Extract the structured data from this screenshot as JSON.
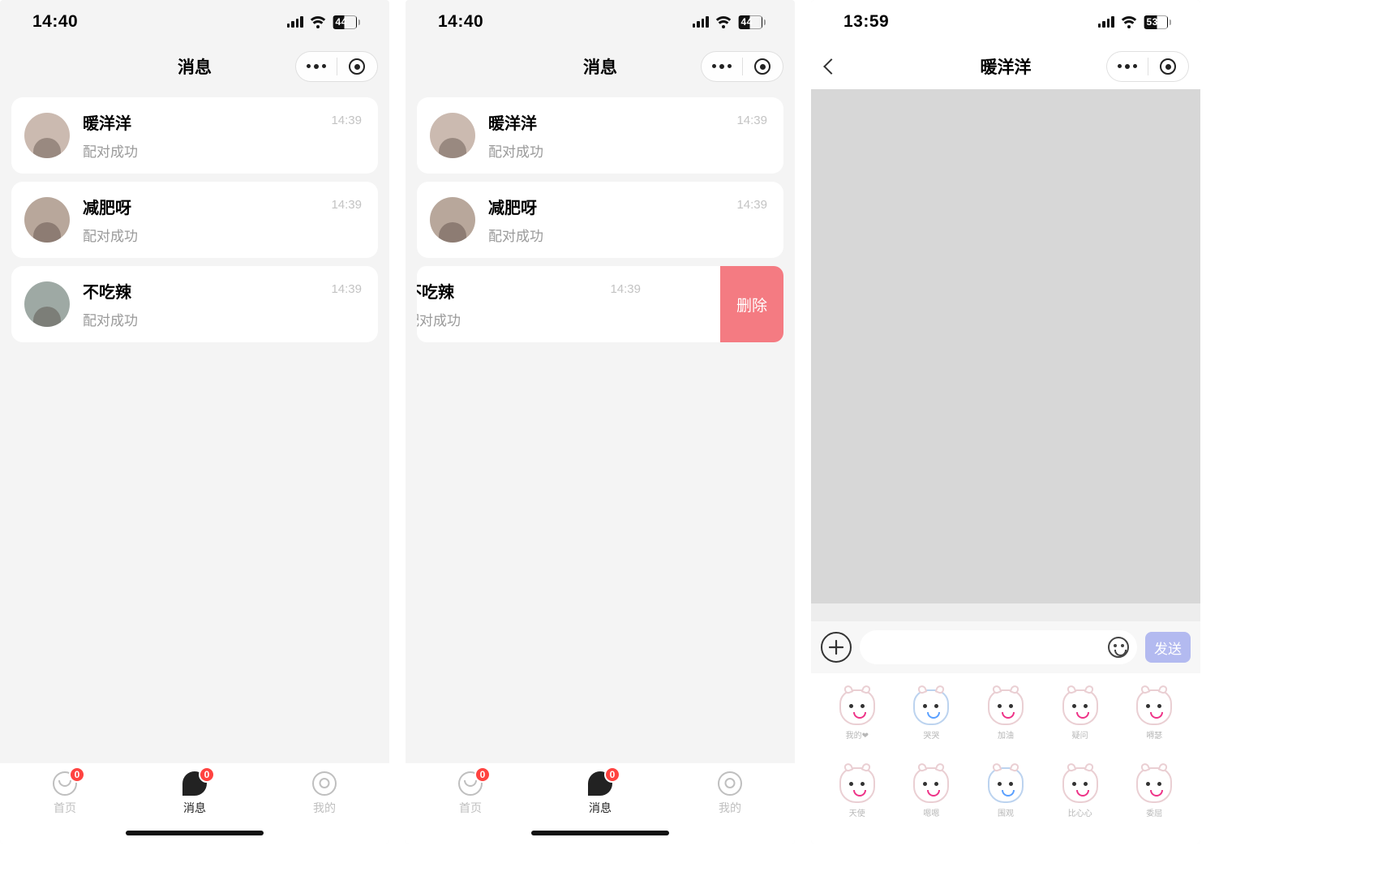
{
  "screens": {
    "s1": {
      "time": "14:40",
      "battery": "44",
      "title": "消息"
    },
    "s2": {
      "time": "14:40",
      "battery": "44",
      "title": "消息",
      "delete_label": "删除"
    },
    "s3": {
      "time": "13:59",
      "battery": "53",
      "title": "暖洋洋",
      "send_label": "发送"
    }
  },
  "conversations": [
    {
      "name": "暖洋洋",
      "sub": "配对成功",
      "time": "14:39"
    },
    {
      "name": "减肥呀",
      "sub": "配对成功",
      "time": "14:39"
    },
    {
      "name": "不吃辣",
      "sub": "配对成功",
      "time": "14:39"
    }
  ],
  "tabs": {
    "home": {
      "label": "首页",
      "badge": "0"
    },
    "msg": {
      "label": "消息",
      "badge": "0"
    },
    "mine": {
      "label": "我的"
    }
  },
  "stickers": [
    "我的❤",
    "哭哭",
    "加油",
    "疑问",
    "嘚瑟",
    "天使",
    "嗯嗯",
    "围观",
    "比心心",
    "委屈"
  ]
}
